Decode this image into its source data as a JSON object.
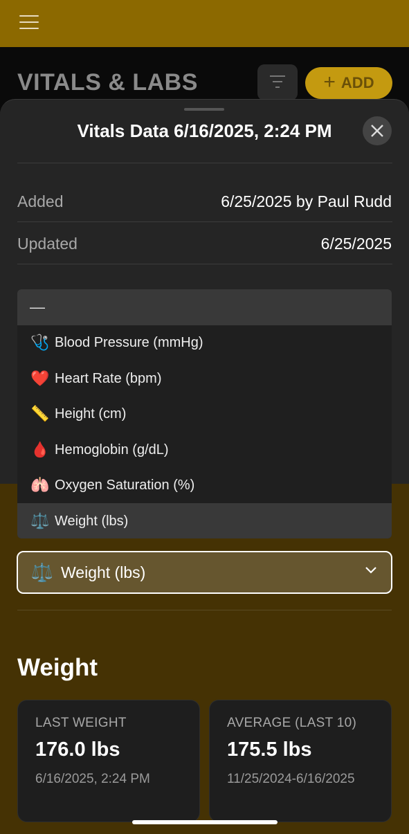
{
  "header": {
    "page_title": "VITALS & LABS",
    "add_label": "ADD",
    "accent": "#c49a10",
    "bar_color": "#8c6900"
  },
  "sheet": {
    "title": "Vitals Data 6/16/2025, 2:24 PM",
    "rows": [
      {
        "label": "Added",
        "value": "6/25/2025 by Paul Rudd"
      },
      {
        "label": "Updated",
        "value": "6/25/2025"
      }
    ]
  },
  "dropdown": {
    "empty_option": "—",
    "options": [
      {
        "icon": "🩺",
        "label": "Blood Pressure (mmHg)"
      },
      {
        "icon": "❤️",
        "label": "Heart Rate (bpm)"
      },
      {
        "icon": "📏",
        "label": "Height (cm)"
      },
      {
        "icon": "🩸",
        "label": "Hemoglobin (g/dL)"
      },
      {
        "icon": "🫁",
        "label": "Oxygen Saturation (%)"
      },
      {
        "icon": "⚖️",
        "label": "Weight (lbs)"
      }
    ]
  },
  "select": {
    "icon": "⚖️",
    "value": "Weight (lbs)"
  },
  "weight": {
    "section_title": "Weight",
    "last": {
      "label": "LAST WEIGHT",
      "value": "176.0 lbs",
      "date": "6/16/2025, 2:24 PM"
    },
    "average": {
      "label": "AVERAGE (LAST 10)",
      "value": "175.5 lbs",
      "date": "11/25/2024-6/16/2025"
    }
  }
}
